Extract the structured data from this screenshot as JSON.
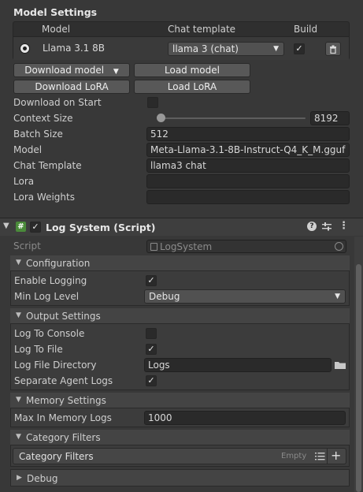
{
  "model_settings": {
    "title": "Model Settings",
    "columns": [
      "Model",
      "Chat template",
      "Build"
    ],
    "row": {
      "model": "Llama 3.1 8B",
      "chat_template": "llama 3 (chat)",
      "build_checked": true
    },
    "buttons": {
      "download_model": "Download model",
      "load_model": "Load model",
      "download_lora": "Download LoRA",
      "load_lora": "Load LoRA"
    },
    "fields": [
      {
        "label": "Download on Start"
      },
      {
        "label": "Context Size",
        "value": "8192"
      },
      {
        "label": "Batch Size",
        "value": "512"
      },
      {
        "label": "Model",
        "value": "Meta-Llama-3.1-8B-Instruct-Q4_K_M.gguf"
      },
      {
        "label": "Chat Template",
        "value": "llama3 chat"
      },
      {
        "label": "Lora",
        "value": ""
      },
      {
        "label": "Lora Weights",
        "value": ""
      }
    ]
  },
  "component": {
    "title": "Log System (Script)",
    "script_label": "Script",
    "script_value": "LogSystem"
  },
  "configuration": {
    "title": "Configuration",
    "enable_logging": "Enable Logging",
    "min_log_level": "Min Log Level",
    "min_log_level_value": "Debug"
  },
  "output_settings": {
    "title": "Output Settings",
    "log_to_console": "Log To Console",
    "log_to_file": "Log To File",
    "log_file_directory": "Log File Directory",
    "log_file_directory_value": "Logs",
    "separate_agent_logs": "Separate Agent Logs"
  },
  "memory_settings": {
    "title": "Memory Settings",
    "max_in_memory_logs": "Max In Memory Logs",
    "max_in_memory_logs_value": "1000"
  },
  "category_filters": {
    "title": "Category Filters",
    "list_label": "Category Filters",
    "empty_text": "Empty"
  },
  "debug": {
    "title": "Debug"
  },
  "icons": {
    "radio": "radio-selected-icon",
    "trash": "trash-icon",
    "script": "script-icon",
    "help": "help-icon",
    "presets": "presets-icon",
    "menu": "kebab-menu-icon",
    "folder": "folder-icon",
    "list": "list-icon",
    "add": "add-icon"
  },
  "colors": {
    "background": "#383838",
    "field": "#2a2a2a",
    "button": "#585858"
  }
}
